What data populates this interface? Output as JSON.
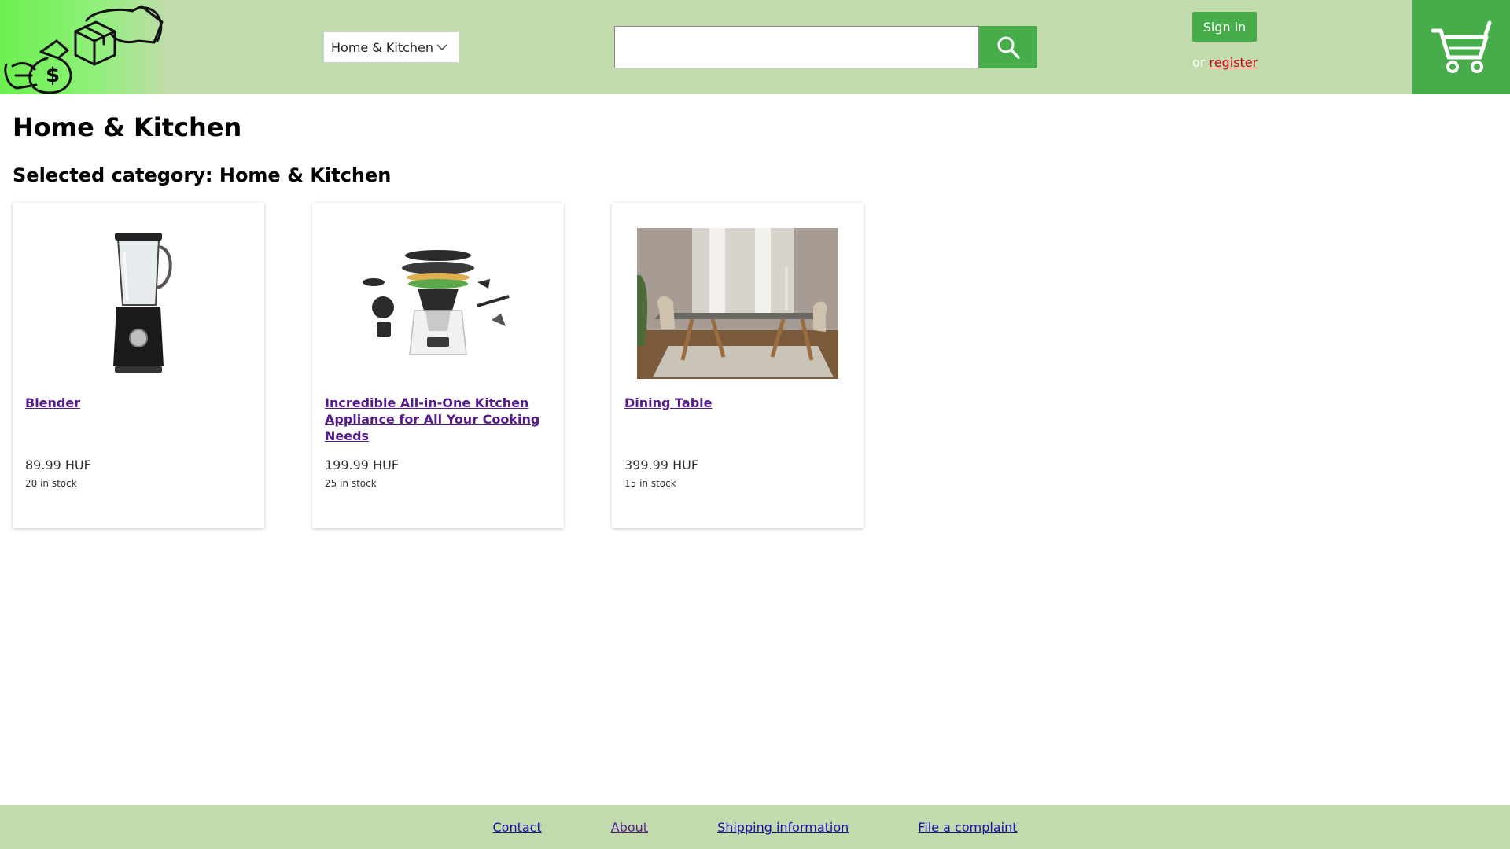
{
  "header": {
    "category_select": {
      "value": "Home & Kitchen"
    },
    "search": {
      "value": "",
      "placeholder": ""
    },
    "signin_label": "Sign in",
    "or_text": "or",
    "register_label": "register"
  },
  "main": {
    "title": "Home & Kitchen",
    "selected_category": "Selected category: Home & Kitchen",
    "products": [
      {
        "name": "Blender",
        "price": "89.99 HUF",
        "stock": "20 in stock",
        "image": "blender-image"
      },
      {
        "name": "Incredible All-in-One Kitchen Appliance for All Your Cooking Needs",
        "price": "199.99 HUF",
        "stock": "25 in stock",
        "image": "kitchen-appliance-image"
      },
      {
        "name": "Dining Table",
        "price": "399.99 HUF",
        "stock": "15 in stock",
        "image": "dining-table-image"
      }
    ]
  },
  "footer": {
    "links": [
      "Contact",
      "About",
      "Shipping information",
      "File a complaint"
    ]
  },
  "colors": {
    "header_bg": "#c2dbad",
    "accent": "#46ad4a",
    "register_link": "#e0001b",
    "product_link": "#551a8b"
  },
  "icons": [
    "logo-money-box-icon",
    "chevron-down-icon",
    "search-icon",
    "cart-icon"
  ]
}
